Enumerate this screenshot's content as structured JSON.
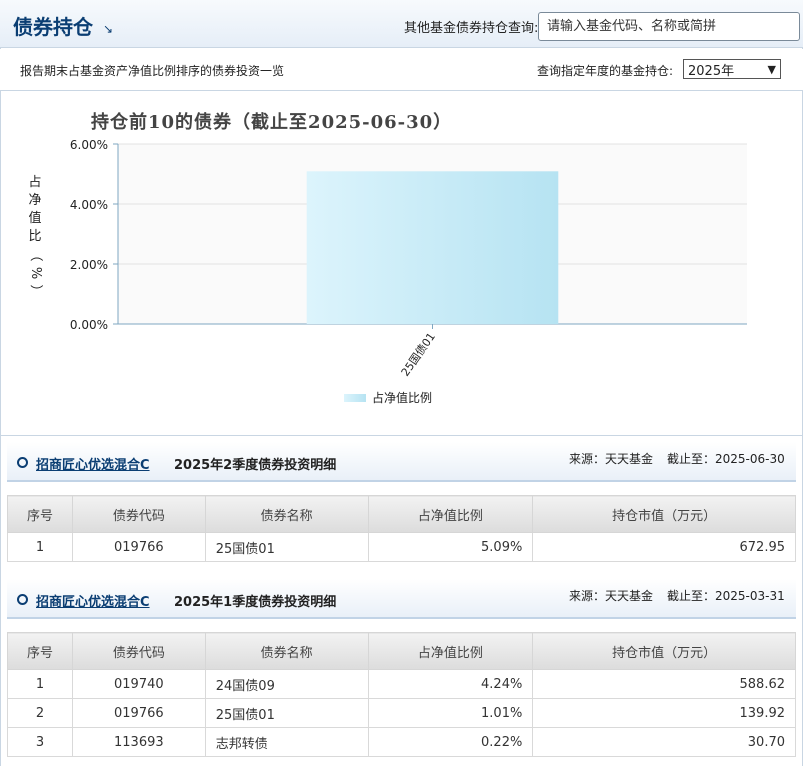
{
  "header": {
    "title": "债券持仓",
    "query_label": "其他基金债券持仓查询:",
    "search_placeholder": "请输入基金代码、名称或简拼"
  },
  "subbar": {
    "description": "报告期末占基金资产净值比例排序的债券投资一览",
    "year_label": "查询指定年度的基金持仓:",
    "year_selected": "2025年"
  },
  "chart_data": {
    "type": "bar",
    "title": "持仓前10的债券（截止至2025-06-30）",
    "ylabel": "占净值比（%）",
    "ylabel_chars": [
      "占",
      "净",
      "值",
      "比",
      "（",
      "%",
      "）"
    ],
    "categories": [
      "25国债01"
    ],
    "values": [
      5.09
    ],
    "ylim": [
      0,
      6
    ],
    "yticks": [
      "0.00%",
      "2.00%",
      "4.00%",
      "6.00%"
    ],
    "grid": true,
    "legend": "占净值比例",
    "legend_position": "bottom"
  },
  "sections": [
    {
      "fund": "招商匠心优选混合C",
      "title": "2025年2季度债券投资明细",
      "source": "来源：天天基金",
      "date": "截止至：2025-06-30",
      "headers": [
        "序号",
        "债券代码",
        "债券名称",
        "占净值比例",
        "持仓市值（万元）"
      ],
      "rows": [
        [
          "1",
          "019766",
          "25国债01",
          "5.09%",
          "672.95"
        ]
      ]
    },
    {
      "fund": "招商匠心优选混合C",
      "title": "2025年1季度债券投资明细",
      "source": "来源：天天基金",
      "date": "截止至：2025-03-31",
      "headers": [
        "序号",
        "债券代码",
        "债券名称",
        "占净值比例",
        "持仓市值（万元）"
      ],
      "rows": [
        [
          "1",
          "019740",
          "24国债09",
          "4.24%",
          "588.62"
        ],
        [
          "2",
          "019766",
          "25国债01",
          "1.01%",
          "139.92"
        ],
        [
          "3",
          "113693",
          "志邦转债",
          "0.22%",
          "30.70"
        ]
      ]
    }
  ],
  "colors": {
    "brand": "#0b3e73",
    "bar_light": "#dcf4fc",
    "bar_dark": "#b6e3f2"
  }
}
